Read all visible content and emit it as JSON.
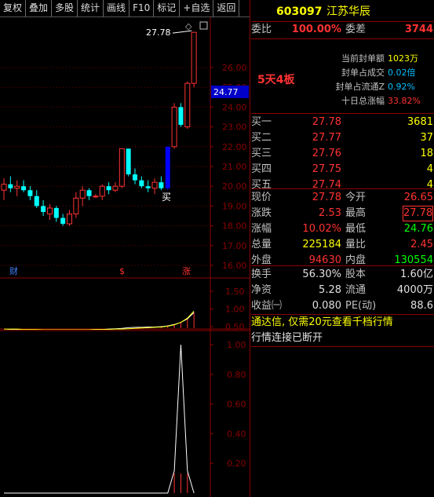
{
  "toolbar": {
    "items": [
      "复权",
      "叠加",
      "多股",
      "统计",
      "画线",
      "F10",
      "标记",
      "+自选",
      "返回"
    ]
  },
  "colors": {
    "up": "#ff3232",
    "down": "#00ffff",
    "blue_bar": "#0000ff",
    "yellow": "#ffff00",
    "green": "#00ff00",
    "white": "#ffffff",
    "label_gray": "#c0c0c0",
    "axis_red": "#8b0000"
  },
  "chart_data": [
    {
      "type": "candlestick",
      "name": "price",
      "y_axis_ticks": [
        "26.00",
        "25.00",
        "24.00",
        "23.00",
        "22.00",
        "21.00",
        "20.00",
        "19.00",
        "18.00",
        "17.00",
        "16.00"
      ],
      "ylim": [
        15.7,
        27.9
      ],
      "current_price_label": "24.77",
      "current_price": 24.77,
      "high_label": "27.78",
      "annotation_buy": "买",
      "markers": [
        "财",
        "$",
        "涨"
      ],
      "candles": [
        {
          "o": 19.8,
          "h": 20.4,
          "l": 19.3,
          "c": 20.1
        },
        {
          "o": 20.1,
          "h": 20.5,
          "l": 19.7,
          "c": 19.9
        },
        {
          "o": 19.9,
          "h": 20.3,
          "l": 19.5,
          "c": 20.0
        },
        {
          "o": 20.0,
          "h": 20.3,
          "l": 19.7,
          "c": 19.8
        },
        {
          "o": 19.8,
          "h": 20.0,
          "l": 19.3,
          "c": 19.5
        },
        {
          "o": 19.5,
          "h": 19.8,
          "l": 18.9,
          "c": 19.0
        },
        {
          "o": 19.0,
          "h": 19.3,
          "l": 18.5,
          "c": 18.7
        },
        {
          "o": 18.6,
          "h": 19.1,
          "l": 18.3,
          "c": 18.9
        },
        {
          "o": 18.9,
          "h": 19.0,
          "l": 18.2,
          "c": 18.4
        },
        {
          "o": 18.4,
          "h": 18.6,
          "l": 18.0,
          "c": 18.1
        },
        {
          "o": 18.1,
          "h": 18.8,
          "l": 18.0,
          "c": 18.6
        },
        {
          "o": 18.6,
          "h": 19.7,
          "l": 18.4,
          "c": 19.4
        },
        {
          "o": 19.4,
          "h": 20.0,
          "l": 19.0,
          "c": 19.8
        },
        {
          "o": 19.8,
          "h": 19.9,
          "l": 19.3,
          "c": 19.5
        },
        {
          "o": 19.5,
          "h": 19.6,
          "l": 19.4,
          "c": 19.5
        },
        {
          "o": 19.5,
          "h": 20.1,
          "l": 19.3,
          "c": 20.0
        },
        {
          "o": 20.0,
          "h": 20.2,
          "l": 19.6,
          "c": 19.8
        },
        {
          "o": 19.8,
          "h": 20.2,
          "l": 19.7,
          "c": 20.0
        },
        {
          "o": 20.0,
          "h": 21.9,
          "l": 19.9,
          "c": 21.9
        },
        {
          "o": 21.9,
          "h": 21.9,
          "l": 20.5,
          "c": 20.6
        },
        {
          "o": 20.6,
          "h": 20.9,
          "l": 20.1,
          "c": 20.3
        },
        {
          "o": 20.3,
          "h": 20.5,
          "l": 19.9,
          "c": 20.0
        },
        {
          "o": 20.0,
          "h": 20.3,
          "l": 19.7,
          "c": 19.9
        },
        {
          "o": 19.9,
          "h": 20.4,
          "l": 19.6,
          "c": 20.2
        },
        {
          "o": 20.2,
          "h": 20.5,
          "l": 19.8,
          "c": 19.9
        },
        {
          "o": 19.9,
          "h": 22.0,
          "l": 19.8,
          "c": 22.0
        },
        {
          "o": 22.0,
          "h": 24.2,
          "l": 21.9,
          "c": 24.0
        },
        {
          "o": 24.0,
          "h": 24.2,
          "l": 23.0,
          "c": 23.1
        },
        {
          "o": 23.0,
          "h": 25.3,
          "l": 22.9,
          "c": 25.2
        },
        {
          "o": 25.2,
          "h": 27.78,
          "l": 25.0,
          "c": 27.78
        }
      ]
    },
    {
      "type": "line",
      "name": "volume-ratio",
      "y_axis_ticks": [
        "1.50",
        "1.00",
        "0.50"
      ],
      "ylim": [
        0.1,
        1.8
      ],
      "series": [
        {
          "values": [
            0.4,
            0.41,
            0.42,
            0.41,
            0.41,
            0.4,
            0.4,
            0.4,
            0.41,
            0.41,
            0.41,
            0.41,
            0.41,
            0.41,
            0.42,
            0.42,
            0.43,
            0.44,
            0.45,
            0.47,
            0.48,
            0.48,
            0.49,
            0.49,
            0.5,
            0.52,
            0.56,
            0.62,
            0.72,
            0.9
          ]
        },
        {
          "values": [
            0.43,
            0.43,
            0.43,
            0.42,
            0.42,
            0.42,
            0.41,
            0.41,
            0.41,
            0.41,
            0.41,
            0.41,
            0.41,
            0.41,
            0.42,
            0.42,
            0.42,
            0.43,
            0.43,
            0.44,
            0.45,
            0.46,
            0.47,
            0.48,
            0.49,
            0.51,
            0.55,
            0.62,
            0.74,
            0.94
          ]
        }
      ]
    },
    {
      "type": "line",
      "name": "indicator",
      "y_axis_ticks": [
        "1.00",
        "0.80",
        "0.60",
        "0.40",
        "0.20"
      ],
      "ylim": [
        0.0,
        1.08
      ],
      "series": [
        {
          "values": [
            0,
            0,
            0,
            0,
            0,
            0,
            0,
            0,
            0,
            0,
            0,
            0,
            0,
            0,
            0,
            0,
            0,
            0,
            0,
            0,
            0,
            0,
            0,
            0,
            0,
            0,
            0.15,
            1.0,
            0.15,
            0
          ]
        }
      ]
    }
  ],
  "panel": {
    "code": "603097",
    "name": "江苏华辰",
    "weibi_label": "委比",
    "weibi_value": "100.00%",
    "weicha_label": "委差",
    "weicha_value": "3744",
    "board_info": "5天4板",
    "seal_items": [
      {
        "label": "当前封单额",
        "value": "1023万"
      },
      {
        "label": "封单占成交",
        "value": "0.02倍"
      },
      {
        "label": "封单占流通Z",
        "value": "0.92%"
      },
      {
        "label": "十日总涨幅",
        "value": "33.82%"
      }
    ],
    "bids": [
      {
        "label": "买一",
        "price": "27.78",
        "vol": "3681"
      },
      {
        "label": "买二",
        "price": "27.77",
        "vol": "37"
      },
      {
        "label": "买三",
        "price": "27.76",
        "vol": "18"
      },
      {
        "label": "买四",
        "price": "27.75",
        "vol": "4"
      },
      {
        "label": "买五",
        "price": "27.74",
        "vol": "4"
      }
    ],
    "quote": [
      {
        "l1": "现价",
        "v1": "27.78",
        "l2": "今开",
        "v2": "26.65"
      },
      {
        "l1": "涨跌",
        "v1": "2.53",
        "l2": "最高",
        "v2": "27.78"
      },
      {
        "l1": "涨幅",
        "v1": "10.02%",
        "l2": "最低",
        "v2": "24.76"
      },
      {
        "l1": "总量",
        "v1": "225184",
        "l2": "量比",
        "v2": "2.45"
      },
      {
        "l1": "外盘",
        "v1": "94630",
        "l2": "内盘",
        "v2": "130554"
      }
    ],
    "fund": [
      {
        "l1": "换手",
        "v1": "56.30%",
        "l2": "股本",
        "v2": "1.60亿"
      },
      {
        "l1": "净资",
        "v1": "5.28",
        "l2": "流通",
        "v2": "4000万"
      },
      {
        "l1": "收益㈠",
        "v1": "0.080",
        "l2": "PE(动)",
        "v2": "88.6"
      }
    ],
    "notice": "通达信, 仅需20元查看千档行情",
    "status": "行情连接已断开"
  }
}
